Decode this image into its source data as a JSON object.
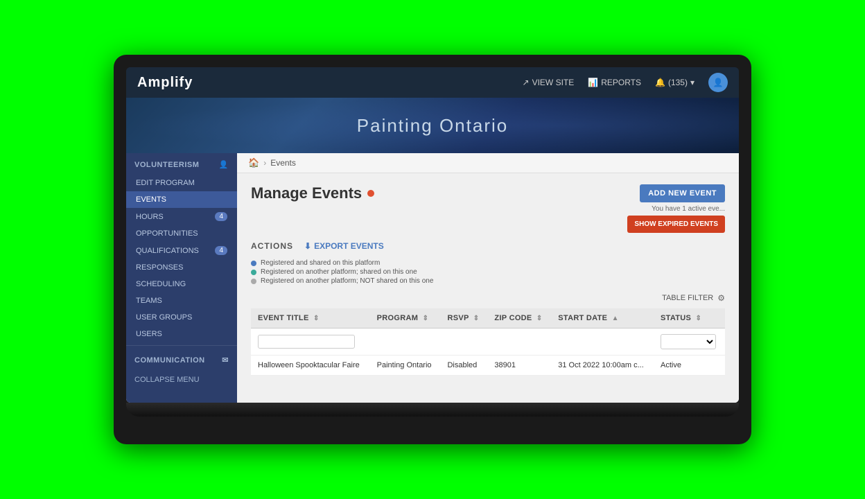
{
  "brand": "Amplify",
  "topNav": {
    "viewSite": "VIEW SITE",
    "reports": "REPORTS",
    "notifications": "(135)",
    "notifLabel": "135"
  },
  "banner": {
    "title": "Painting Ontario"
  },
  "breadcrumb": {
    "home": "🏠",
    "separator": "›",
    "current": "Events"
  },
  "pageTitle": "Manage Events",
  "actions": {
    "label": "ACTIONS",
    "exportBtn": "EXPORT EVENTS"
  },
  "legend": [
    {
      "color": "blue",
      "text": "Registered and shared on this platform"
    },
    {
      "color": "teal",
      "text": "Registered on another platform; shared on this one"
    },
    {
      "color": "gray",
      "text": "Registered on another platform; NOT shared on this one"
    }
  ],
  "buttons": {
    "addEvent": "ADD NEW EVENT",
    "showExpired": "SHOW EXPIRED EVENTS",
    "activeNotice": "You have 1 active eve..."
  },
  "tableFilter": "TABLE FILTER",
  "table": {
    "columns": [
      {
        "label": "EVENT TITLE",
        "key": "title"
      },
      {
        "label": "PROGRAM",
        "key": "program"
      },
      {
        "label": "RSVP",
        "key": "rsvp"
      },
      {
        "label": "ZIP CODE",
        "key": "zipCode"
      },
      {
        "label": "START DATE",
        "key": "startDate"
      },
      {
        "label": "STATUS",
        "key": "status"
      }
    ],
    "rows": [
      {
        "title": "Halloween Spooktacular Faire",
        "program": "Painting Ontario",
        "rsvp": "Disabled",
        "zipCode": "38901",
        "startDate": "31 Oct 2022 10:00am c...",
        "status": "Active"
      }
    ]
  },
  "sidebar": {
    "sectionLabel": "VOLUNTEERISM",
    "items": [
      {
        "label": "EDIT PROGRAM",
        "active": false,
        "badge": null
      },
      {
        "label": "EVENTS",
        "active": true,
        "badge": null
      },
      {
        "label": "HOURS",
        "active": false,
        "badge": "4"
      },
      {
        "label": "OPPORTUNITIES",
        "active": false,
        "badge": null
      },
      {
        "label": "QUALIFICATIONS",
        "active": false,
        "badge": "4"
      },
      {
        "label": "RESPONSES",
        "active": false,
        "badge": null
      },
      {
        "label": "SCHEDULING",
        "active": false,
        "badge": null
      },
      {
        "label": "TEAMS",
        "active": false,
        "badge": null
      },
      {
        "label": "USER GROUPS",
        "active": false,
        "badge": null
      },
      {
        "label": "USERS",
        "active": false,
        "badge": null
      }
    ],
    "communication": {
      "label": "COMMUNICATION"
    },
    "collapseMenu": "COLLAPSE MENU"
  }
}
